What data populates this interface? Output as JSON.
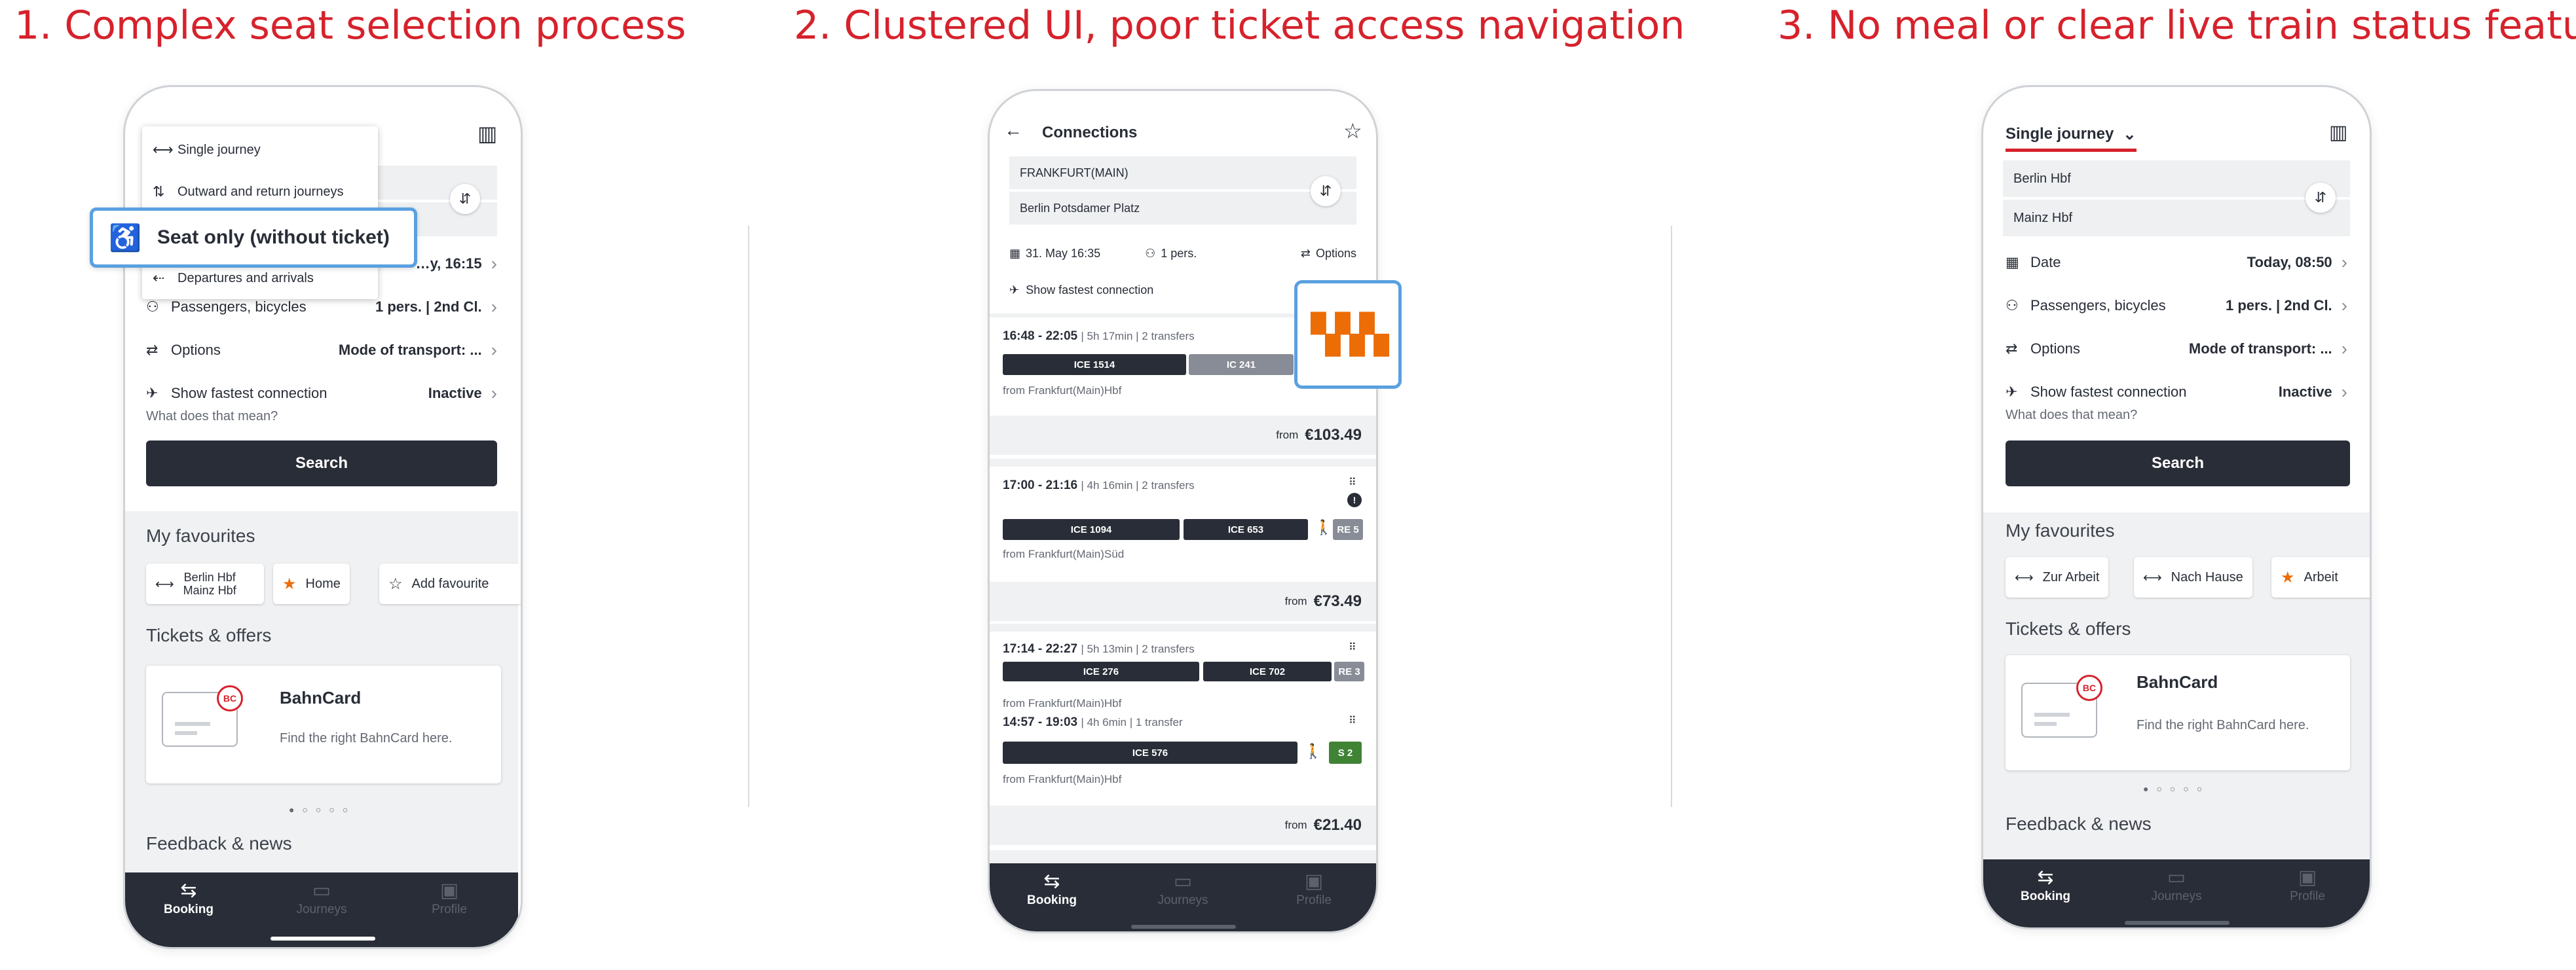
{
  "titles": [
    "1. Complex seat selection process",
    "2. Clustered UI, poor ticket access navigation",
    "3. No meal or clear live train status features"
  ],
  "colors": {
    "accent_red": "#d6222c",
    "db_dark": "#282d37",
    "highlight_blue": "#5aa0e0",
    "seat_orange": "#ec6c06",
    "regional_green": "#408335"
  },
  "nav": {
    "booking": "Booking",
    "journeys": "Journeys",
    "profile": "Profile"
  },
  "phone1": {
    "menu": {
      "single": "Single journey",
      "outward": "Outward and return journeys",
      "seat": "Seat only (without ticket)",
      "departures": "Departures and arrivals"
    },
    "date_value": "…y, 16:15",
    "passengers_label": "Passengers, bicycles",
    "passengers_value": "1 pers. | 2nd Cl.",
    "options_label": "Options",
    "options_value": "Mode of transport: ...",
    "fastest_label": "Show fastest connection",
    "fastest_value": "Inactive",
    "fastest_help": "What does that mean?",
    "search": "Search",
    "favourites_title": "My favourites",
    "fav1_line1": "Berlin Hbf",
    "fav1_line2": "Mainz Hbf",
    "fav2": "Home",
    "fav3": "Add favourite",
    "tickets_title": "Tickets & offers",
    "card_title": "BahnCard",
    "card_text": "Find the right BahnCard here.",
    "bc_badge": "BC",
    "feedback_title": "Feedback & news"
  },
  "phone2": {
    "title": "Connections",
    "from": "FRANKFURT(MAIN)",
    "to": "Berlin Potsdamer Platz",
    "date": "31. May 16:35",
    "persons": "1 pers.",
    "options": "Options",
    "fastest": "Show fastest connection",
    "connections": [
      {
        "time": "16:48 - 22:05",
        "meta": "| 5h 17min | 2 transfers",
        "trains": [
          "ICE 1514",
          "IC 241"
        ],
        "from": "from Frankfurt(Main)Hbf",
        "price_from": "from",
        "price": "€103.49"
      },
      {
        "time": "17:00 - 21:16",
        "meta": "| 4h 16min | 2 transfers",
        "trains": [
          "ICE 1094",
          "ICE 653",
          "RE 5"
        ],
        "from": "from Frankfurt(Main)Süd",
        "price_from": "from",
        "price": "€73.49"
      },
      {
        "time": "17:14 - 22:27",
        "meta": "| 5h 13min | 2 transfers",
        "trains": [
          "ICE 276",
          "ICE 702",
          "RE 3"
        ],
        "from": "from Frankfurt(Main)Hbf"
      },
      {
        "time": "14:57 - 19:03",
        "meta": "| 4h 6min | 1 transfer",
        "trains": [
          "ICE 576",
          "S 2"
        ],
        "from": "from Frankfurt(Main)Hbf",
        "price_from": "from",
        "price": "€21.40"
      }
    ]
  },
  "phone3": {
    "tab": "Single journey",
    "from": "Berlin Hbf",
    "to": "Mainz Hbf",
    "date_label": "Date",
    "date_value": "Today, 08:50",
    "passengers_label": "Passengers, bicycles",
    "passengers_value": "1 pers. | 2nd Cl.",
    "options_label": "Options",
    "options_value": "Mode of transport: ...",
    "fastest_label": "Show fastest connection",
    "fastest_value": "Inactive",
    "fastest_help": "What does that mean?",
    "search": "Search",
    "favourites_title": "My favourites",
    "fav1": "Zur Arbeit",
    "fav2": "Nach Hause",
    "fav3": "Arbeit",
    "tickets_title": "Tickets & offers",
    "card_title": "BahnCard",
    "card_text": "Find the right BahnCard here.",
    "bc_badge": "BC",
    "feedback_title": "Feedback & news"
  }
}
